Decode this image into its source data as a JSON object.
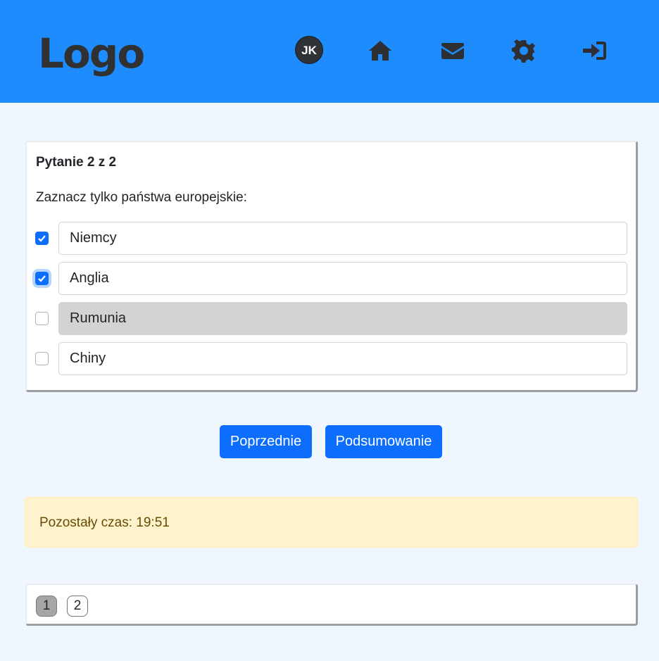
{
  "header": {
    "logo": "Logo",
    "avatar_initials": "JK",
    "nav_icons": [
      "home-icon",
      "envelope-icon",
      "gear-icon",
      "sign-in-icon"
    ],
    "color": "#1e8cfd"
  },
  "question": {
    "title": "Pytanie 2 z 2",
    "text": "Zaznacz tylko państwa europejskie:",
    "options": [
      {
        "label": "Niemcy",
        "checked": true
      },
      {
        "label": "Anglia",
        "checked": true
      },
      {
        "label": "Rumunia",
        "checked": false
      },
      {
        "label": "Chiny",
        "checked": false
      }
    ]
  },
  "buttons": {
    "previous": "Poprzednie",
    "summary": "Podsumowanie"
  },
  "timer": {
    "text": "Pozostały czas: 19:51"
  },
  "pagination": {
    "pages": [
      "1",
      "2"
    ],
    "active": "1"
  }
}
